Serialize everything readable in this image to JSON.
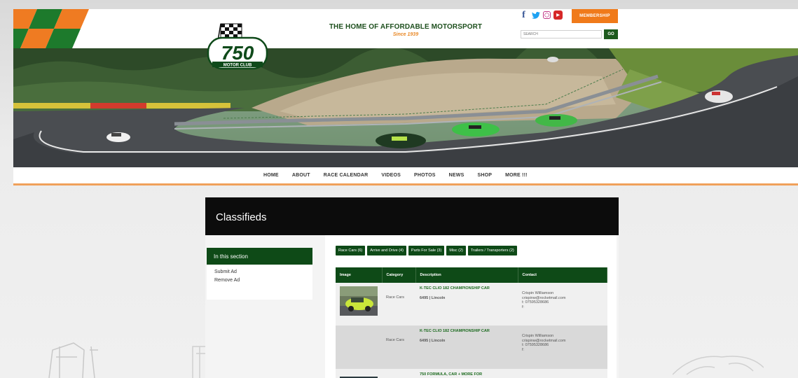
{
  "header": {
    "tagline": "THE HOME OF AFFORDABLE MOTORSPORT",
    "since": "Since 1939",
    "membership_label": "MEMBERSHIP",
    "search_placeholder": "SEARCH",
    "go_label": "GO",
    "logo_number": "750",
    "logo_sub": "MOTOR CLUB",
    "social": [
      "facebook-icon",
      "twitter-icon",
      "instagram-icon",
      "youtube-icon"
    ]
  },
  "nav": {
    "items": [
      "HOME",
      "ABOUT",
      "RACE CALENDAR",
      "VIDEOS",
      "PHOTOS",
      "NEWS",
      "SHOP",
      "MORE !!!"
    ]
  },
  "page": {
    "title": "Classifieds"
  },
  "sidebar": {
    "heading": "In this section",
    "links": [
      "Submit Ad",
      "Remove Ad"
    ]
  },
  "filters": [
    "Race Cars (6)",
    "Arrive and Drive (4)",
    "Parts For Sale (3)",
    "Misc (2)",
    "Trailers / Transporters (2)"
  ],
  "table": {
    "headers": [
      "Image",
      "Category",
      "Description",
      "Contact"
    ],
    "rows": [
      {
        "category": "Race Cars",
        "title": "K-TEC CLIO 182 CHAMPIONSHIP CAR",
        "price_location": "6495 | Lincoln",
        "contact_name": "Crispin Williamson",
        "contact_email": "crispinw@rocketmail.com",
        "contact_tel": "t: 07595328686",
        "contact_extra": "f:"
      },
      {
        "category": "Race Cars",
        "title": "K-TEC CLIO 182 CHAMPIONSHIP CAR",
        "price_location": "6495 | Lincoln",
        "contact_name": "Crispin Williamson",
        "contact_email": "crispinw@rocketmail.com",
        "contact_tel": "t: 07595328686",
        "contact_extra": "f:"
      },
      {
        "title": "750 FORMULA, CAR + MORE FOR"
      }
    ]
  },
  "colors": {
    "brand_green": "#0e4a17",
    "accent_orange": "#f07a1a",
    "title_bar": "#0c0c0c"
  }
}
